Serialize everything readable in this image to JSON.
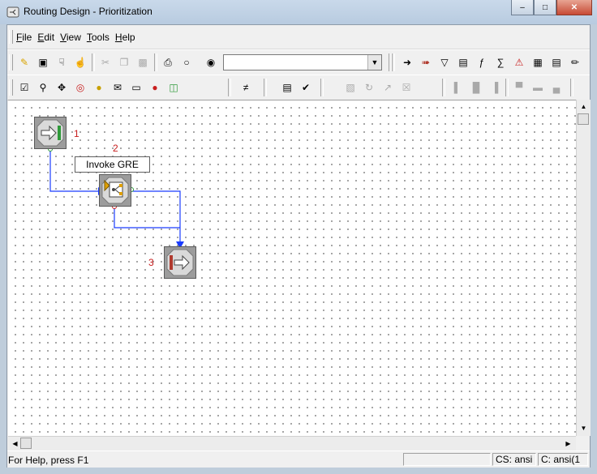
{
  "window": {
    "title": "Routing Design - Prioritization",
    "minimize_glyph": "–",
    "maximize_glyph": "□",
    "close_glyph": "✕"
  },
  "menu": {
    "items": [
      {
        "label": "File",
        "mnemonic": "F"
      },
      {
        "label": "Edit",
        "mnemonic": "E"
      },
      {
        "label": "View",
        "mnemonic": "V"
      },
      {
        "label": "Tools",
        "mnemonic": "T"
      },
      {
        "label": "Help",
        "mnemonic": "H"
      }
    ]
  },
  "toolbar": {
    "search_value": "",
    "combo_arrow": "▼"
  },
  "canvas": {
    "callout_label": "Invoke GRE",
    "nodes": [
      {
        "id": "1",
        "type": "start"
      },
      {
        "id": "2",
        "type": "invoke-gre"
      },
      {
        "id": "3",
        "type": "end"
      }
    ]
  },
  "scroll": {
    "up": "▲",
    "down": "▼",
    "left": "◀",
    "right": "▶"
  },
  "status": {
    "help_text": "For Help, press F1",
    "cs": "CS: ansi",
    "c": "C: ansi(1"
  },
  "colors": {
    "connector": "#1a3cff",
    "node_label": "#c81e1e",
    "start_bar": "#2f9a3a",
    "end_bar": "#b03a2e"
  }
}
